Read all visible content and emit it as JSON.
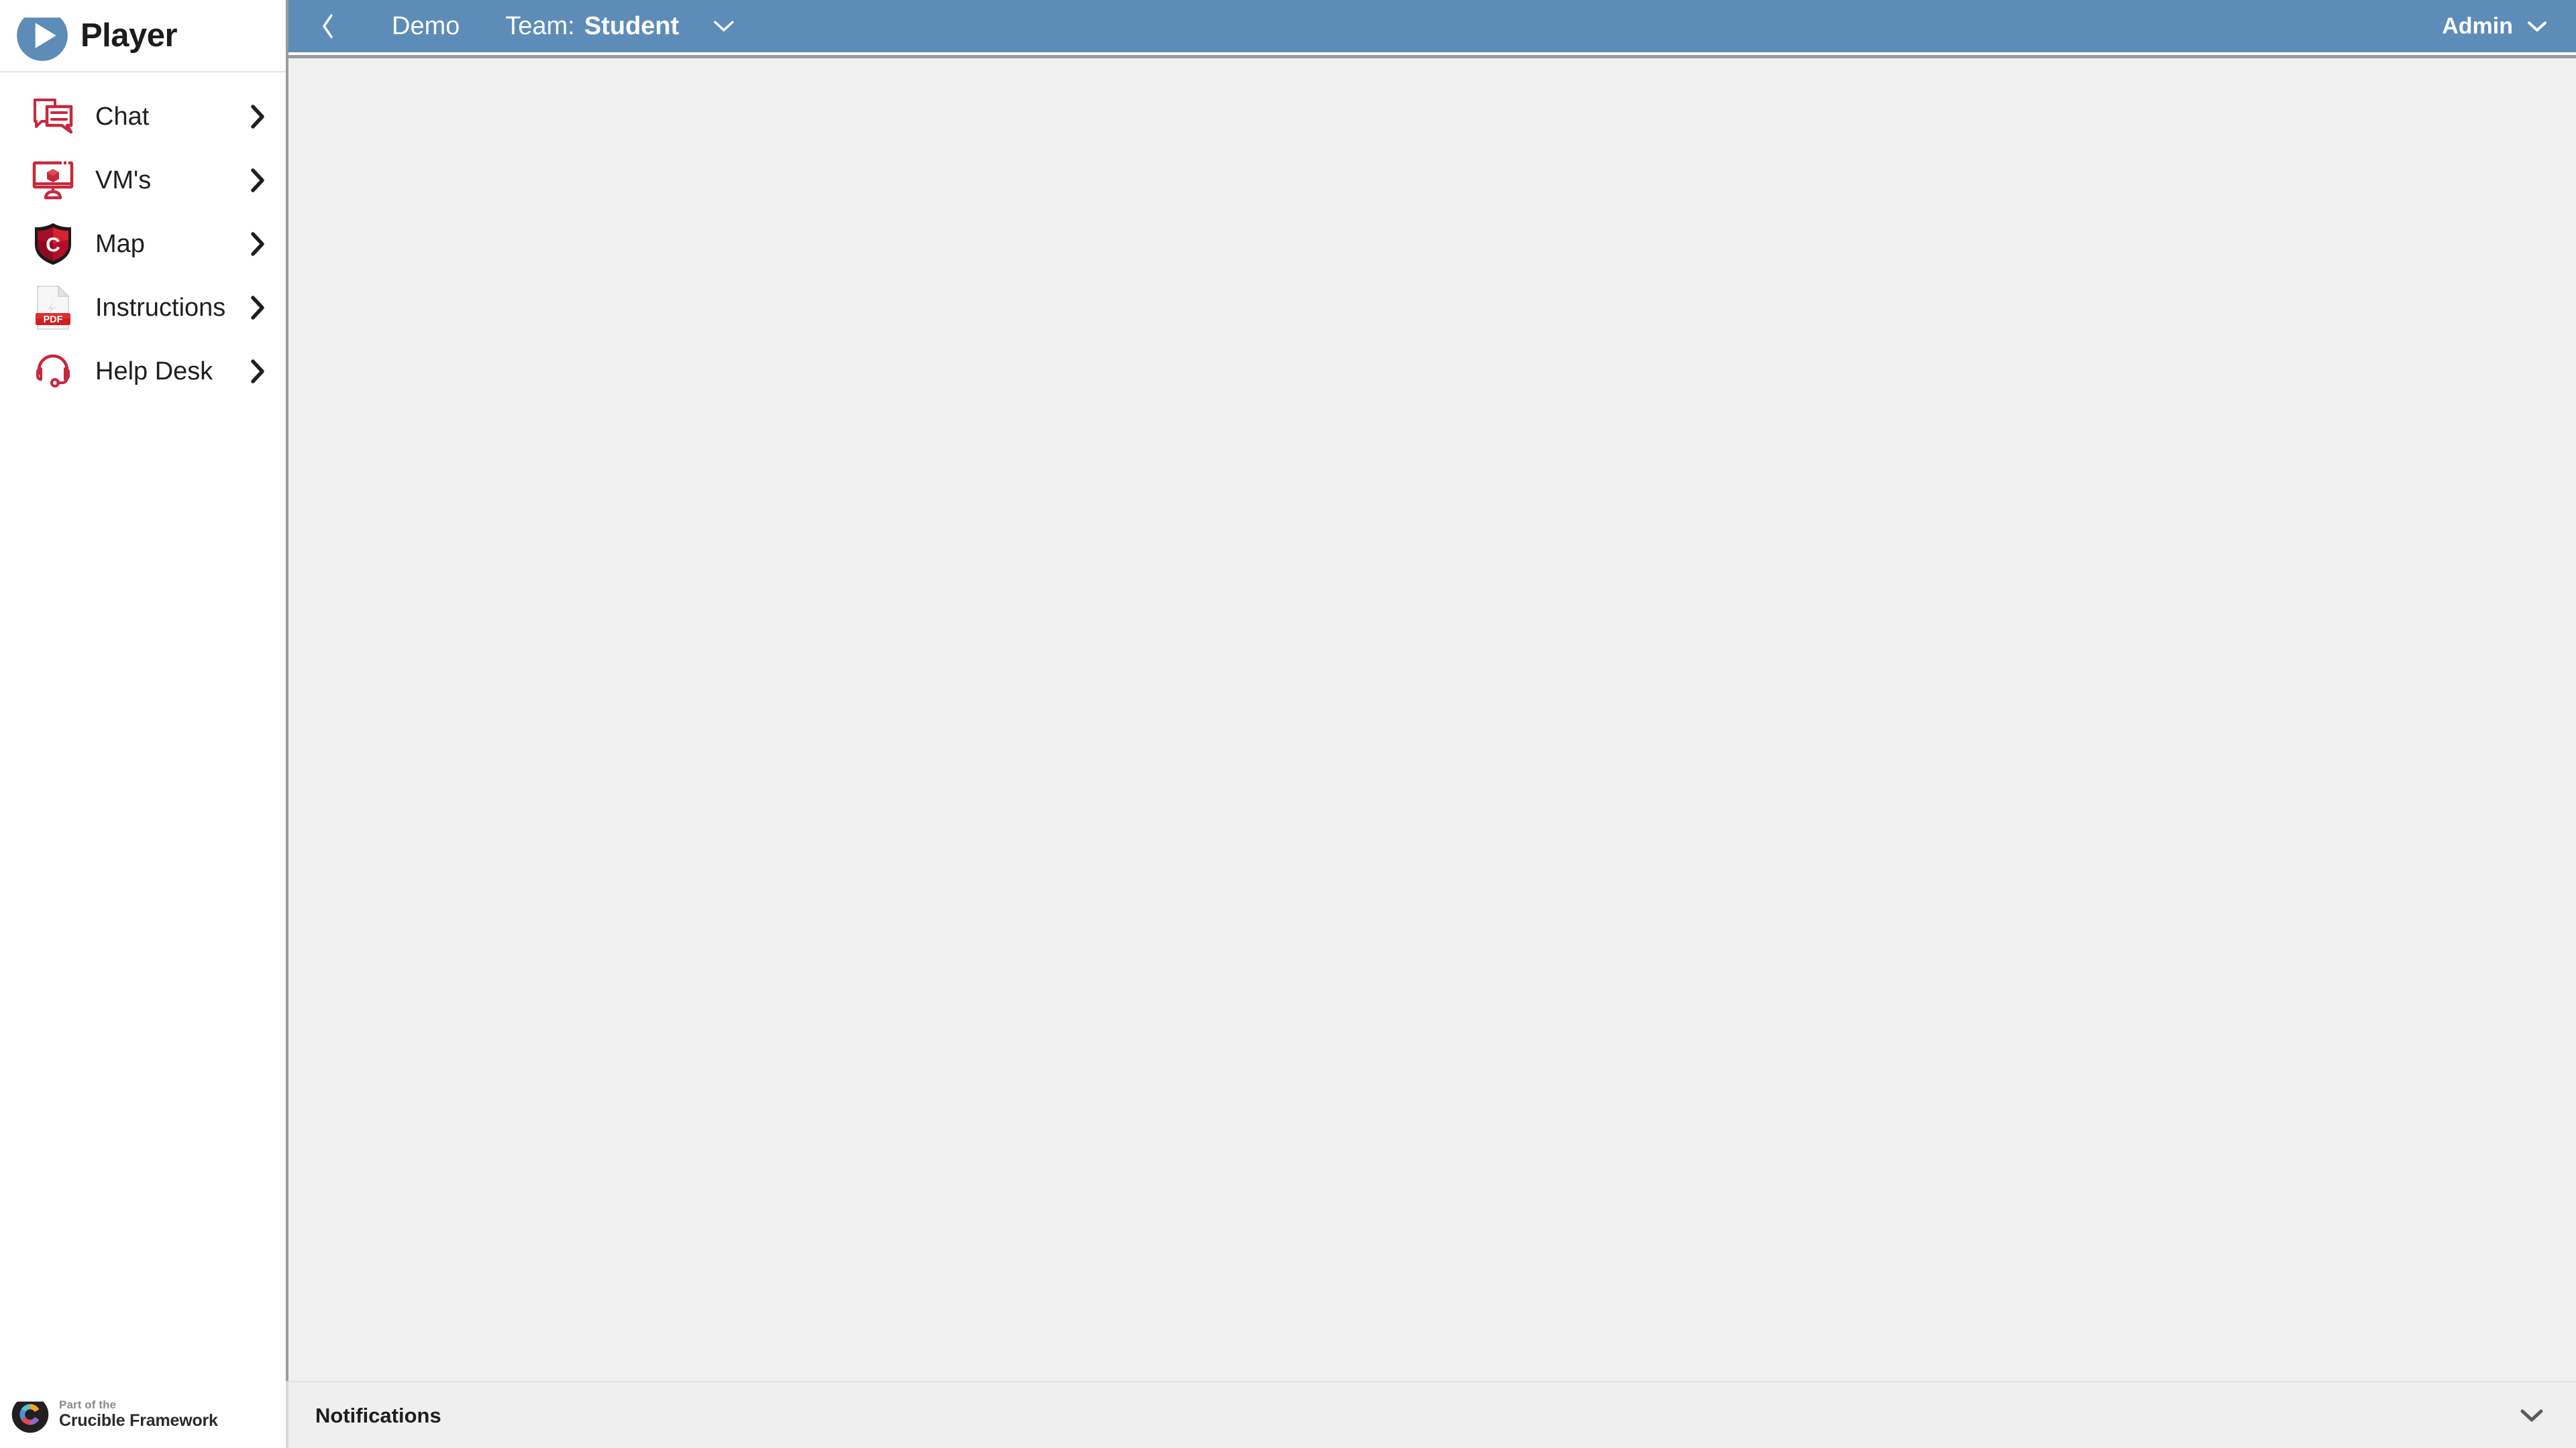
{
  "app": {
    "name": "Player",
    "logo_icon": "player-droplet-play-logo",
    "logo_color": "#5d8cb8"
  },
  "sidebar": {
    "items": [
      {
        "label": "Chat",
        "icon": "chat-bubbles-icon",
        "chevron": "chevron-right-icon"
      },
      {
        "label": "VM's",
        "icon": "monitor-vm-icon",
        "chevron": "chevron-right-icon"
      },
      {
        "label": "Map",
        "icon": "shield-c-icon",
        "chevron": "chevron-right-icon"
      },
      {
        "label": "Instructions",
        "icon": "pdf-document-icon",
        "chevron": "chevron-right-icon"
      },
      {
        "label": "Help Desk",
        "icon": "headset-icon",
        "chevron": "chevron-right-icon"
      }
    ],
    "footer": {
      "part_of_the": "Part of the",
      "framework_name": "Crucible Framework",
      "logo_icon": "crucible-droplet-c-logo"
    },
    "accent_color": "#c8102e"
  },
  "topbar": {
    "back_icon": "chevron-left-icon",
    "exercise_name": "Demo",
    "team_label": "Team:",
    "team_name": "Student",
    "team_chevron_icon": "chevron-down-icon",
    "user_name": "Admin",
    "user_chevron_icon": "chevron-down-icon",
    "background_color": "#5d8cb8"
  },
  "content": {
    "background_color": "#f0f0f0"
  },
  "notifications": {
    "title": "Notifications",
    "collapse_icon": "chevron-down-icon"
  }
}
